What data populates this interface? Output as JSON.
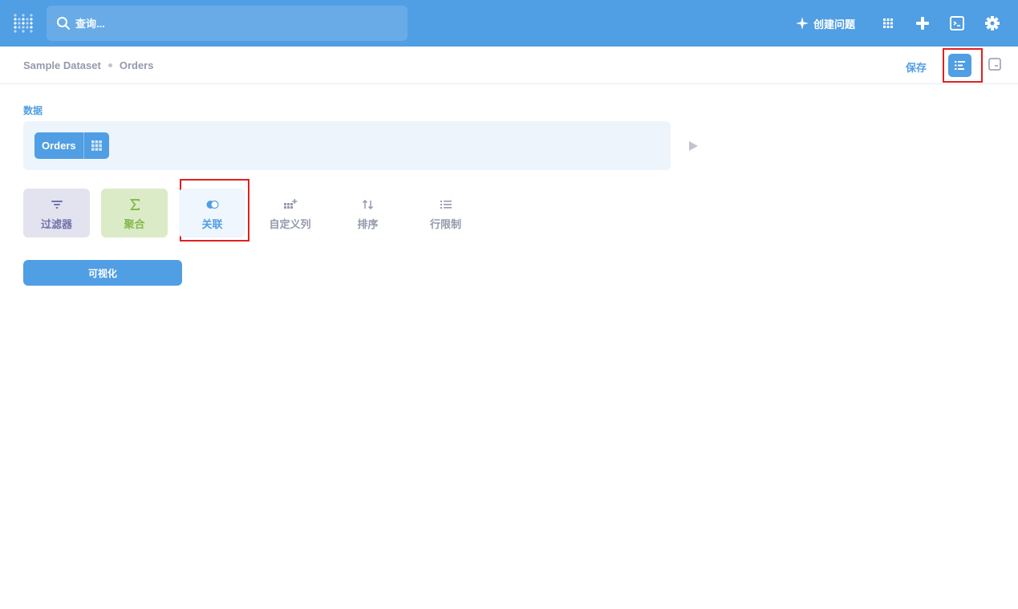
{
  "colors": {
    "brand": "#509ee3",
    "filter": "#7172ad",
    "summarize": "#84bb4c",
    "muted": "#949aab",
    "highlight": "#e02020"
  },
  "navbar": {
    "logo_icon": "metabase-logo-icon",
    "search": {
      "placeholder": "查询..."
    },
    "new_question_label": "创建问题",
    "icons": [
      "sparkle-icon",
      "grid-icon",
      "plus-icon",
      "sql-editor-icon",
      "gear-icon"
    ]
  },
  "header": {
    "breadcrumb": [
      "Sample Dataset",
      "Orders"
    ],
    "save_label": "保存"
  },
  "notebook": {
    "data_step_label": "数据",
    "table_name": "Orders",
    "actions": [
      {
        "label": "过滤器",
        "icon": "filter-icon"
      },
      {
        "label": "聚合",
        "icon": "sum-icon"
      },
      {
        "label": "关联",
        "icon": "join-icon"
      },
      {
        "label": "自定义列",
        "icon": "add-column-icon"
      },
      {
        "label": "排序",
        "icon": "sort-icon"
      },
      {
        "label": "行限制",
        "icon": "list-icon"
      }
    ],
    "visualize_label": "可视化"
  }
}
